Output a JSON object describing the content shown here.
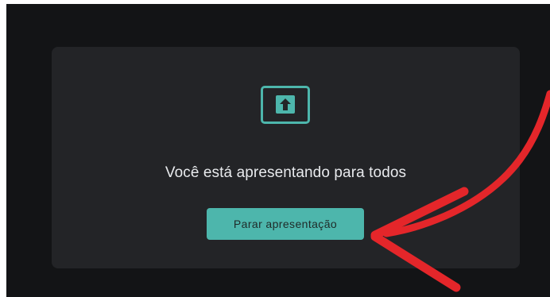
{
  "presentation": {
    "message": "Você está apresentando para todos",
    "stop_button_label": "Parar apresentação",
    "icon": "present-to-all-icon"
  },
  "colors": {
    "page_background": "#131416",
    "panel_background": "#232427",
    "accent": "#4db6ac",
    "message_text": "#e8eaed",
    "annotation_arrow": "#e4262a"
  },
  "annotation": {
    "icon": "red-curved-arrow-icon"
  }
}
